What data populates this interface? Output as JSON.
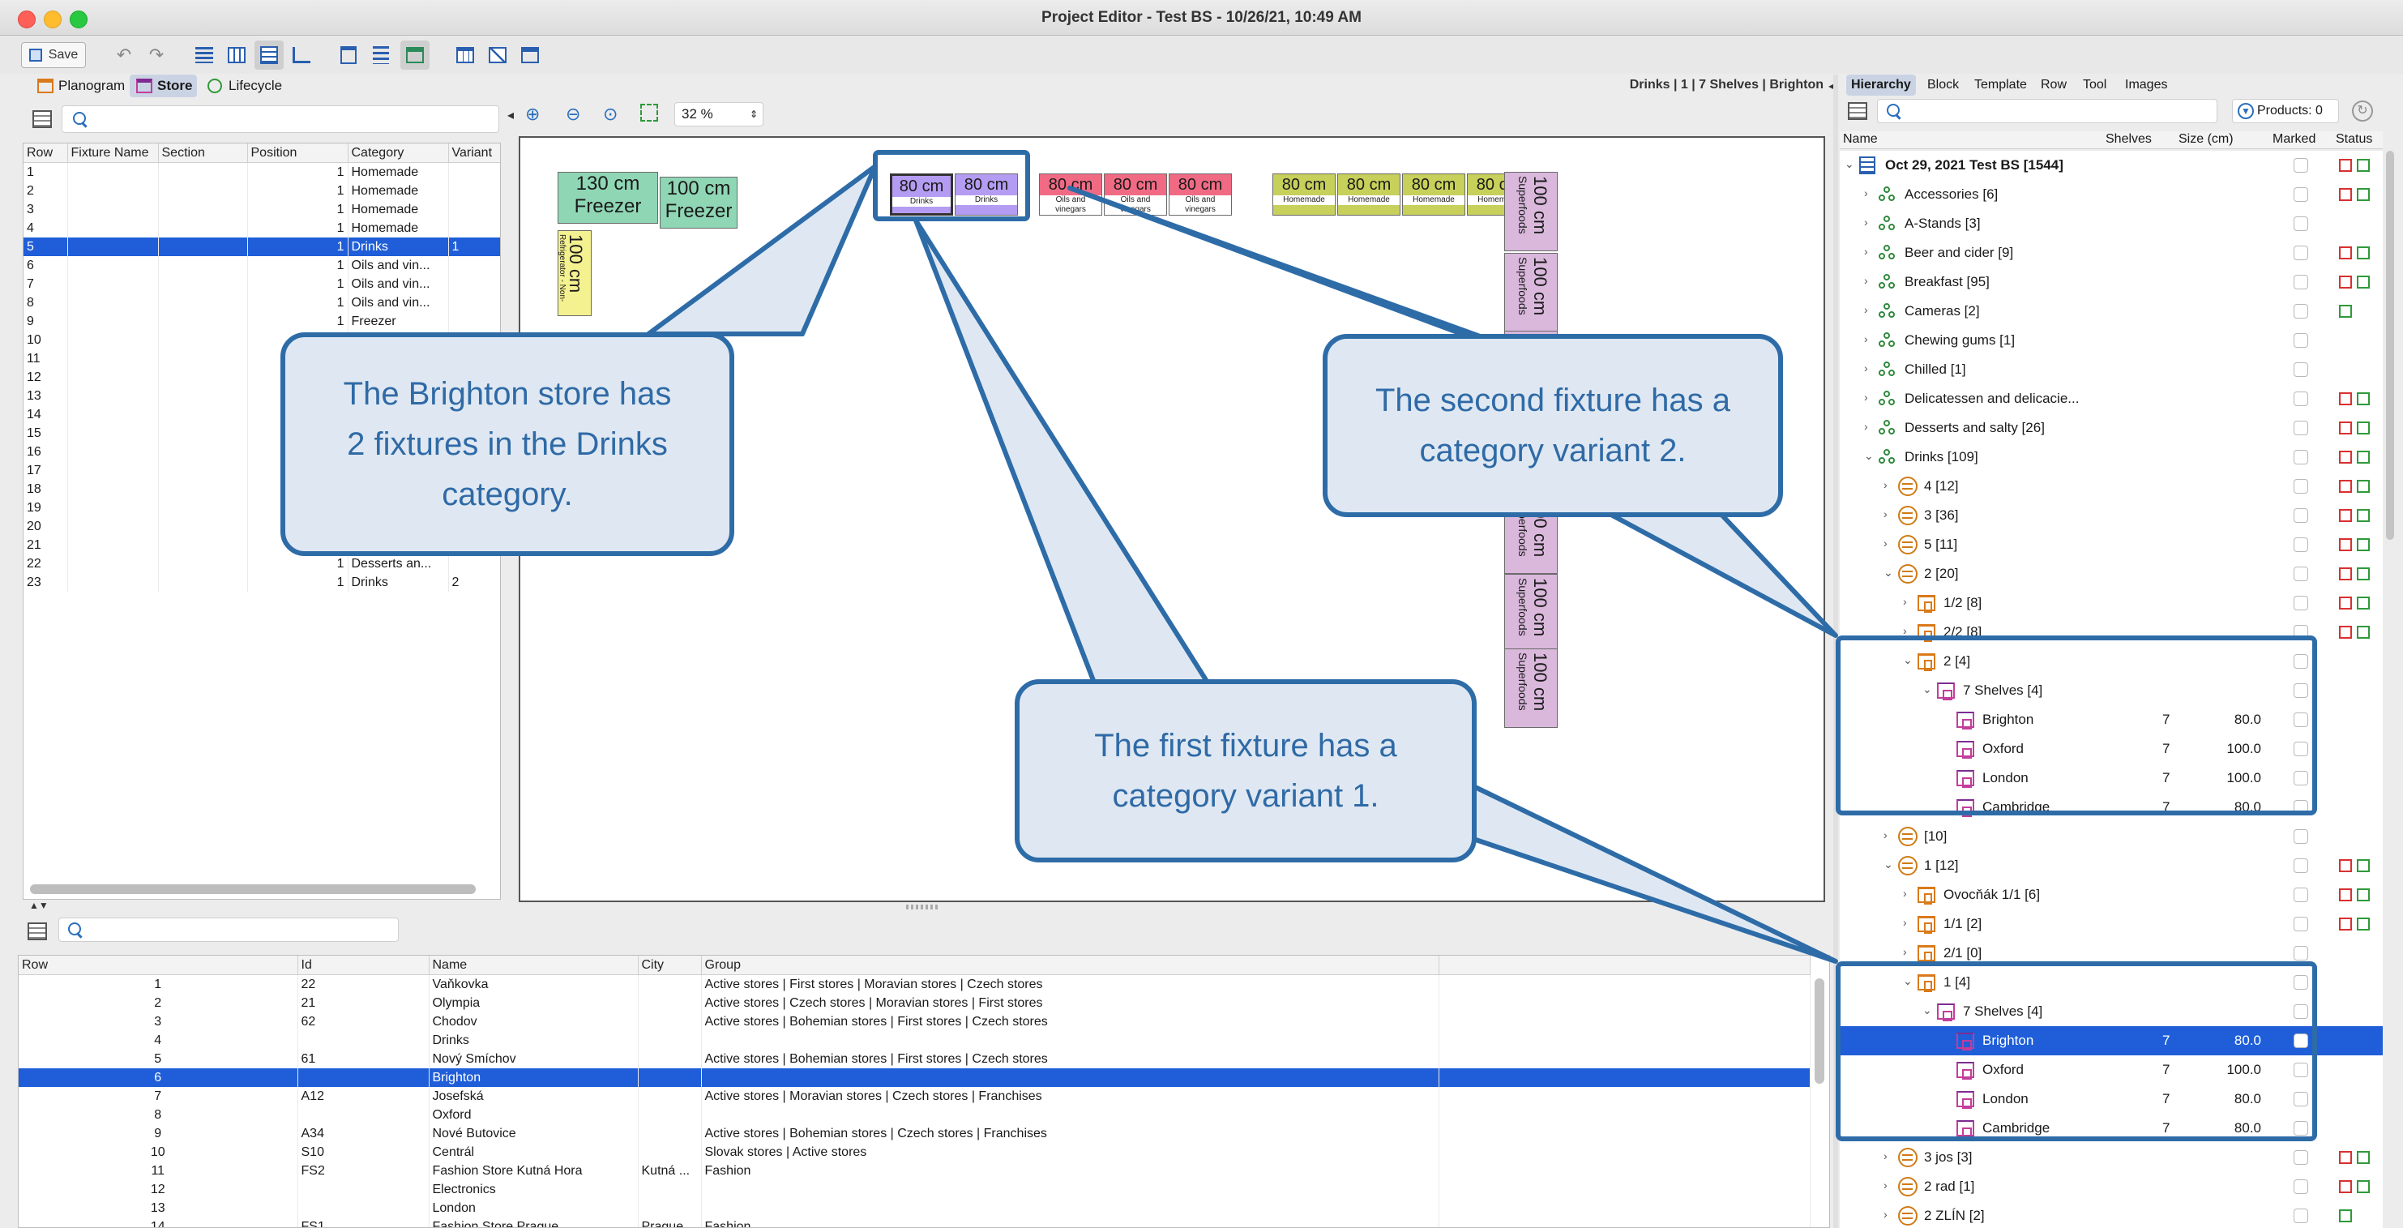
{
  "window": {
    "title": "Project Editor - Test BS - 10/26/21, 10:49 AM"
  },
  "toolbar": {
    "save_label": "Save",
    "zoom_value": "32 %"
  },
  "tabs": {
    "planogram": "Planogram",
    "store": "Store",
    "lifecycle": "Lifecycle"
  },
  "breadcrumb": "Drinks | 1 | 7 Shelves | Brighton",
  "right_tabs": [
    "Hierarchy",
    "Block",
    "Template",
    "Row",
    "Tool",
    "Images"
  ],
  "products_label": "Products: 0",
  "fixture_table": {
    "columns": [
      "Row",
      "Fixture Name",
      "Section",
      "Position",
      "Category",
      "Variant"
    ],
    "rows": [
      [
        "1",
        "",
        "",
        "1",
        "Homemade",
        ""
      ],
      [
        "2",
        "",
        "",
        "1",
        "Homemade",
        ""
      ],
      [
        "3",
        "",
        "",
        "1",
        "Homemade",
        ""
      ],
      [
        "4",
        "",
        "",
        "1",
        "Homemade",
        ""
      ],
      [
        "5",
        "",
        "",
        "1",
        "Drinks",
        "1"
      ],
      [
        "6",
        "",
        "",
        "1",
        "Oils and vin...",
        ""
      ],
      [
        "7",
        "",
        "",
        "1",
        "Oils and vin...",
        ""
      ],
      [
        "8",
        "",
        "",
        "1",
        "Oils and vin...",
        ""
      ],
      [
        "9",
        "",
        "",
        "1",
        "Freezer",
        ""
      ],
      [
        "10",
        "",
        "",
        "",
        "",
        ""
      ],
      [
        "11",
        "",
        "",
        "",
        "",
        ""
      ],
      [
        "12",
        "",
        "",
        "",
        "",
        ""
      ],
      [
        "13",
        "",
        "",
        "",
        "",
        ""
      ],
      [
        "14",
        "",
        "",
        "",
        "",
        ""
      ],
      [
        "15",
        "",
        "",
        "",
        "",
        ""
      ],
      [
        "16",
        "",
        "",
        "",
        "",
        ""
      ],
      [
        "17",
        "",
        "",
        "",
        "",
        ""
      ],
      [
        "18",
        "",
        "",
        "",
        "",
        ""
      ],
      [
        "19",
        "",
        "",
        "",
        "",
        ""
      ],
      [
        "20",
        "",
        "",
        "",
        "",
        ""
      ],
      [
        "21",
        "",
        "",
        "",
        "",
        ""
      ],
      [
        "22",
        "",
        "",
        "1",
        "Desserts an...",
        ""
      ],
      [
        "23",
        "",
        "",
        "1",
        "Drinks",
        "2"
      ]
    ],
    "selected_index": 4
  },
  "store_table": {
    "columns": [
      "Row",
      "Id",
      "Name",
      "City",
      "Group"
    ],
    "rows": [
      [
        "1",
        "22",
        "Vaňkovka",
        "",
        "Active stores | First stores | Moravian stores | Czech stores"
      ],
      [
        "2",
        "21",
        "Olympia",
        "",
        "Active stores | Czech stores | Moravian stores | First stores"
      ],
      [
        "3",
        "62",
        "Chodov",
        "",
        "Active stores | Bohemian stores | First stores | Czech stores"
      ],
      [
        "4",
        "",
        "Drinks",
        "",
        ""
      ],
      [
        "5",
        "61",
        "Nový Smíchov",
        "",
        "Active stores | Bohemian stores | First stores | Czech stores"
      ],
      [
        "6",
        "",
        "Brighton",
        "",
        ""
      ],
      [
        "7",
        "A12",
        "Josefská",
        "",
        "Active stores | Moravian stores | Czech stores | Franchises"
      ],
      [
        "8",
        "",
        "Oxford",
        "",
        ""
      ],
      [
        "9",
        "A34",
        "Nové Butovice",
        "",
        "Active stores | Bohemian stores | Czech stores | Franchises"
      ],
      [
        "10",
        "S10",
        "Centrál",
        "",
        "Slovak stores | Active stores"
      ],
      [
        "11",
        "FS2",
        "Fashion Store Kutná Hora",
        "Kutná ...",
        "Fashion"
      ],
      [
        "12",
        "",
        "Electronics",
        "",
        ""
      ],
      [
        "13",
        "",
        "London",
        "",
        ""
      ],
      [
        "14",
        "FS1",
        "Fashion Store Prague",
        "Prague",
        "Fashion"
      ]
    ],
    "selected_index": 5
  },
  "canvas": {
    "freezers": [
      {
        "size": "130 cm",
        "label": "Freezer"
      },
      {
        "size": "100 cm",
        "label": "Freezer"
      }
    ],
    "fridge": {
      "size": "100 cm",
      "label": "Refrigerator - Non-alcoholic"
    },
    "top_row": [
      {
        "size": "80 cm",
        "label": "Drinks"
      },
      {
        "size": "80 cm",
        "label": "Drinks"
      },
      {
        "size": "80 cm",
        "label": "Oils and vinegars"
      },
      {
        "size": "80 cm",
        "label": "Oils and vinegars"
      },
      {
        "size": "80 cm",
        "label": "Oils and vinegars"
      },
      {
        "size": "80 cm",
        "label": "Homemade"
      },
      {
        "size": "80 cm",
        "label": "Homemade"
      },
      {
        "size": "80 cm",
        "label": "Homemade"
      },
      {
        "size": "80 cm",
        "label": "Homemade"
      }
    ],
    "superfoods": {
      "size": "100 cm",
      "label": "Superfoods"
    }
  },
  "callouts": {
    "c1": "The Brighton store has 2 fixtures in the Drinks category.",
    "c2": "The second fixture has a category variant 2.",
    "c3": "The first fixture has a category variant 1."
  },
  "tree_header": {
    "name": "Name",
    "shelves": "Shelves",
    "size": "Size (cm)",
    "marked": "Marked",
    "status": "Status"
  },
  "tree": [
    {
      "label": "Oct 29, 2021 Test BS [1544]",
      "indent": 0,
      "icon": "doc",
      "caret": "v",
      "bold": true,
      "status": "rg"
    },
    {
      "label": "Accessories [6]",
      "indent": 1,
      "icon": "cat",
      "caret": ">",
      "status": "rg"
    },
    {
      "label": "A-Stands [3]",
      "indent": 1,
      "icon": "cat",
      "caret": ">",
      "status": ""
    },
    {
      "label": "Beer and cider [9]",
      "indent": 1,
      "icon": "cat",
      "caret": ">",
      "status": "rg"
    },
    {
      "label": "Breakfast [95]",
      "indent": 1,
      "icon": "cat",
      "caret": ">",
      "status": "rg"
    },
    {
      "label": "Cameras [2]",
      "indent": 1,
      "icon": "cat",
      "caret": ">",
      "status": "g"
    },
    {
      "label": "Chewing gums [1]",
      "indent": 1,
      "icon": "cat",
      "caret": ">",
      "status": ""
    },
    {
      "label": "Chilled [1]",
      "indent": 1,
      "icon": "cat",
      "caret": ">",
      "status": ""
    },
    {
      "label": "Delicatessen and delicacie...",
      "indent": 1,
      "icon": "cat",
      "caret": ">",
      "status": "rg"
    },
    {
      "label": "Desserts and salty [26]",
      "indent": 1,
      "icon": "cat",
      "caret": ">",
      "status": "rg"
    },
    {
      "label": "Drinks [109]",
      "indent": 1,
      "icon": "cat",
      "caret": "v",
      "status": "rg"
    },
    {
      "label": "4 [12]",
      "indent": 2,
      "icon": "var",
      "caret": ">",
      "status": "rg"
    },
    {
      "label": "3 [36]",
      "indent": 2,
      "icon": "var",
      "caret": ">",
      "status": "rg"
    },
    {
      "label": "5 [11]",
      "indent": 2,
      "icon": "var",
      "caret": ">",
      "status": "rg"
    },
    {
      "label": "2 [20]",
      "indent": 2,
      "icon": "var",
      "caret": "v",
      "status": "rg"
    },
    {
      "label": "1/2 [8]",
      "indent": 3,
      "icon": "fx",
      "caret": ">",
      "status": "rg"
    },
    {
      "label": "2/2 [8]",
      "indent": 3,
      "icon": "fx",
      "caret": ">",
      "status": "rg"
    },
    {
      "label": "2 [4]",
      "indent": 3,
      "icon": "fx",
      "caret": "v",
      "status": ""
    },
    {
      "label": "7 Shelves [4]",
      "indent": 4,
      "icon": "sh",
      "caret": "v",
      "status": ""
    },
    {
      "label": "Brighton",
      "indent": 5,
      "icon": "sh",
      "caret": "",
      "shelves": "7",
      "size": "80.0",
      "status": ""
    },
    {
      "label": "Oxford",
      "indent": 5,
      "icon": "sh",
      "caret": "",
      "shelves": "7",
      "size": "100.0",
      "status": ""
    },
    {
      "label": "London",
      "indent": 5,
      "icon": "sh",
      "caret": "",
      "shelves": "7",
      "size": "100.0",
      "status": ""
    },
    {
      "label": "Cambridge",
      "indent": 5,
      "icon": "sh",
      "caret": "",
      "shelves": "7",
      "size": "80.0",
      "status": ""
    },
    {
      "label": "[10]",
      "indent": 2,
      "icon": "var",
      "caret": ">",
      "status": ""
    },
    {
      "label": "1 [12]",
      "indent": 2,
      "icon": "var",
      "caret": "v",
      "status": "rg"
    },
    {
      "label": "Ovocňák 1/1 [6]",
      "indent": 3,
      "icon": "fx",
      "caret": ">",
      "status": "rg"
    },
    {
      "label": "1/1 [2]",
      "indent": 3,
      "icon": "fx",
      "caret": ">",
      "status": "rg"
    },
    {
      "label": "2/1 [0]",
      "indent": 3,
      "icon": "fx",
      "caret": ">",
      "status": ""
    },
    {
      "label": "1 [4]",
      "indent": 3,
      "icon": "fx",
      "caret": "v",
      "status": ""
    },
    {
      "label": "7 Shelves [4]",
      "indent": 4,
      "icon": "sh",
      "caret": "v",
      "status": ""
    },
    {
      "label": "Brighton",
      "indent": 5,
      "icon": "sh",
      "caret": "",
      "shelves": "7",
      "size": "80.0",
      "status": "",
      "selected": true
    },
    {
      "label": "Oxford",
      "indent": 5,
      "icon": "sh",
      "caret": "",
      "shelves": "7",
      "size": "100.0",
      "status": ""
    },
    {
      "label": "London",
      "indent": 5,
      "icon": "sh",
      "caret": "",
      "shelves": "7",
      "size": "80.0",
      "status": ""
    },
    {
      "label": "Cambridge",
      "indent": 5,
      "icon": "sh",
      "caret": "",
      "shelves": "7",
      "size": "80.0",
      "status": ""
    },
    {
      "label": "3 jos [3]",
      "indent": 2,
      "icon": "var",
      "caret": ">",
      "status": "rg"
    },
    {
      "label": "2 rad [1]",
      "indent": 2,
      "icon": "var",
      "caret": ">",
      "status": "rg"
    },
    {
      "label": "2 ZLÍN [2]",
      "indent": 2,
      "icon": "var",
      "caret": ">",
      "status": "g"
    }
  ],
  "colors": {
    "accent": "#2e6ca8",
    "selection": "#1f5ed8",
    "status_red": "#d93030",
    "status_green": "#2f9a3a"
  }
}
